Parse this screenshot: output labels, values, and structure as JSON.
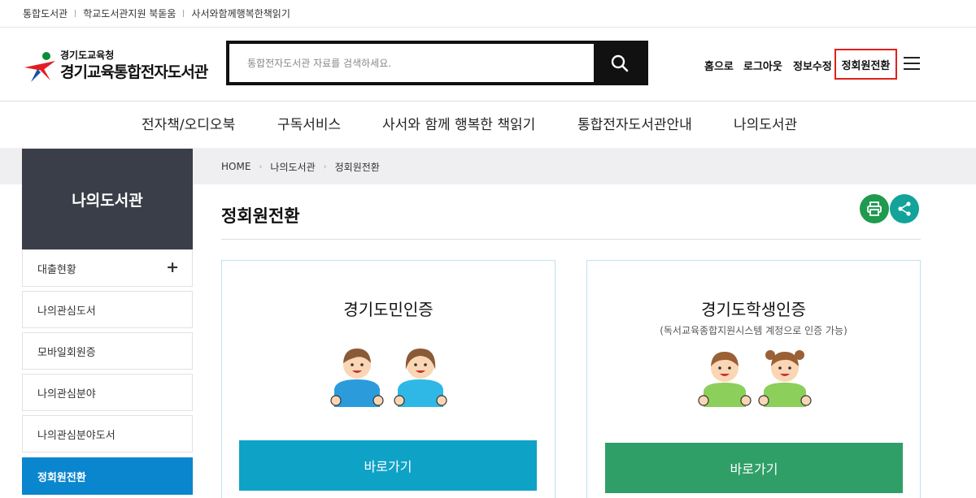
{
  "topbar": {
    "links": [
      "통합도서관",
      "학교도서관지원 북돋움",
      "사서와함께행복한책읽기"
    ]
  },
  "header": {
    "logo_sub": "경기도교육청",
    "logo_main": "경기교육통합전자도서관",
    "search_placeholder": "통합전자도서관 자료를 검색하세요.",
    "util_home": "홈으로",
    "util_logout": "로그아웃",
    "util_edit": "정보수정",
    "util_convert": "정회원전환"
  },
  "gnb": [
    "전자책/오디오북",
    "구독서비스",
    "사서와 함께 행복한 책읽기",
    "통합전자도서관안내",
    "나의도서관"
  ],
  "sidebar": {
    "title": "나의도서관",
    "items": [
      {
        "label": "대출현황"
      },
      {
        "label": "나의관심도서"
      },
      {
        "label": "모바일회원증"
      },
      {
        "label": "나의관심분야"
      },
      {
        "label": "나의관심분야도서"
      },
      {
        "label": "정회원전환"
      }
    ]
  },
  "breadcrumb": [
    "HOME",
    "나의도서관",
    "정회원전환"
  ],
  "page_title": "정회원전환",
  "cards": [
    {
      "title": "경기도민인증",
      "button": "바로가기",
      "color": "#0fa2c7"
    },
    {
      "title": "경기도학생인증",
      "subtitle": "(독서교육종합지원시스템 계정으로 인증 가능)",
      "button": "바로가기",
      "color": "#2f9f67"
    }
  ],
  "colors": {
    "accent_red": "#e0211d",
    "sidebar_dark": "#3a3e48",
    "sidebar_active": "#0a86cf",
    "print_icon_bg": "#1f9a4e",
    "share_icon_bg": "#13a39a"
  },
  "icons": [
    "search-icon",
    "hamburger-icon",
    "plus-icon",
    "print-icon",
    "share-icon"
  ]
}
